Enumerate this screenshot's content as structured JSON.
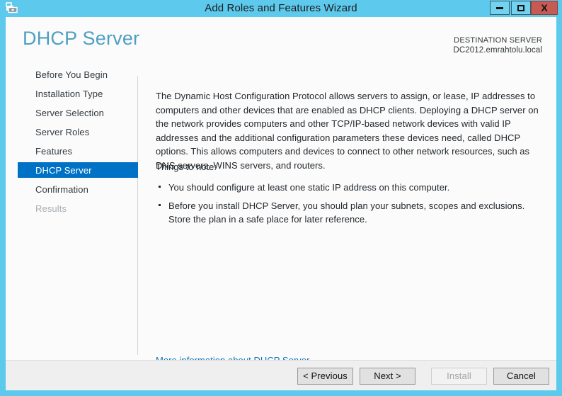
{
  "window": {
    "title": "Add Roles and Features Wizard",
    "icon": "server-manager-icon",
    "controls": {
      "minimize": "minimize-icon",
      "maximize": "maximize-icon",
      "close": "X"
    },
    "frame_color": "#5dc9ec",
    "close_color": "#c75b53"
  },
  "header": {
    "page_title": "DHCP Server",
    "destination_label": "DESTINATION SERVER",
    "destination_server": "DC2012.emrahtolu.local",
    "title_color": "#4f9fc4"
  },
  "sidebar": {
    "selected_color": "#0072c6",
    "items": [
      {
        "label": "Before You Begin",
        "state": "normal"
      },
      {
        "label": "Installation Type",
        "state": "normal"
      },
      {
        "label": "Server Selection",
        "state": "normal"
      },
      {
        "label": "Server Roles",
        "state": "normal"
      },
      {
        "label": "Features",
        "state": "normal"
      },
      {
        "label": "DHCP Server",
        "state": "selected"
      },
      {
        "label": "Confirmation",
        "state": "normal"
      },
      {
        "label": "Results",
        "state": "disabled"
      }
    ]
  },
  "content": {
    "intro_paragraph": "The Dynamic Host Configuration Protocol allows servers to assign, or lease, IP addresses to computers and other devices that are enabled as DHCP clients. Deploying a DHCP server on the network provides computers and other TCP/IP-based network devices with valid IP addresses and the additional configuration parameters these devices need, called DHCP options. This allows computers and devices to connect to other network resources, such as DNS servers, WINS servers, and routers.",
    "things_to_note_label": "Things to note:",
    "notes": [
      "You should configure at least one static IP address on this computer.",
      "Before you install DHCP Server, you should plan your subnets, scopes and exclusions. Store the plan in a safe place for later reference."
    ],
    "more_info_link": "More information about DHCP Server",
    "link_color": "#1273b5"
  },
  "footer": {
    "buttons": [
      {
        "label": "< Previous",
        "state": "enabled"
      },
      {
        "label": "Next >",
        "state": "enabled"
      },
      {
        "label": "Install",
        "state": "disabled"
      },
      {
        "label": "Cancel",
        "state": "enabled"
      }
    ]
  }
}
